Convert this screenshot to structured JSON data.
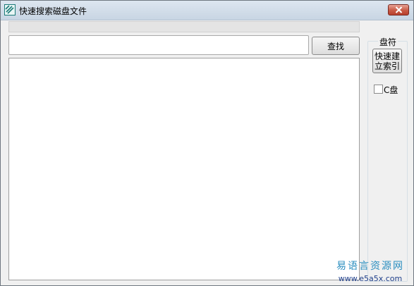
{
  "window": {
    "title": "快速搜索磁盘文件"
  },
  "search": {
    "value": "",
    "placeholder": "",
    "find_label": "查找"
  },
  "drive_panel": {
    "group_label": "盘符",
    "index_button_line1": "快速建",
    "index_button_line2": "立索引",
    "drives": [
      {
        "label": "C盘",
        "checked": false
      }
    ]
  },
  "results": [],
  "watermark": {
    "line1": "易语言资源网",
    "line2": "www.e5a5x.com"
  },
  "icons": {
    "app": "app-logo-icon",
    "close": "close-icon"
  },
  "colors": {
    "title_bar": "#c8d5e3",
    "close_button": "#c85a45",
    "watermark_primary": "#2c8fc0",
    "watermark_secondary": "#1f3f8a"
  }
}
